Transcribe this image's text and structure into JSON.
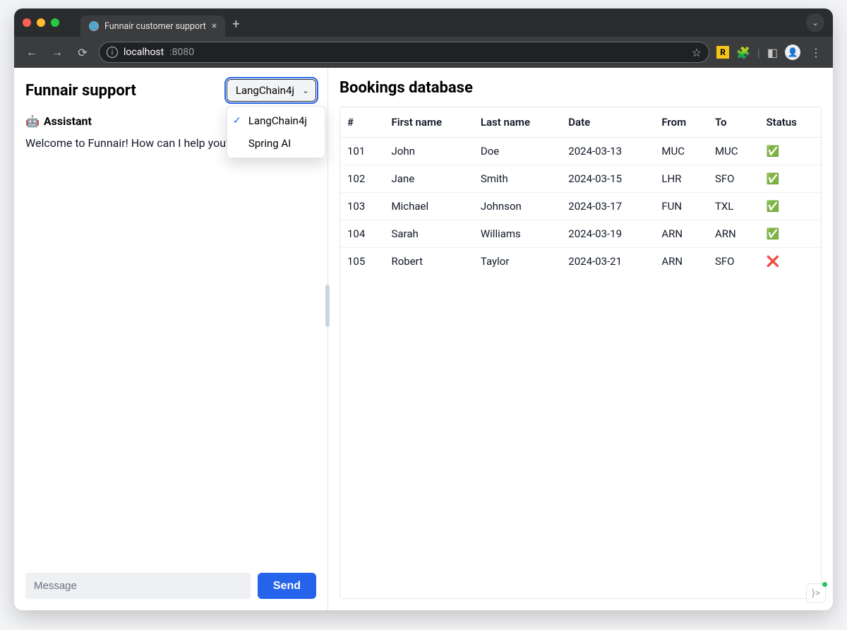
{
  "browser": {
    "tab_title": "Funnair customer support",
    "url_host": "localhost",
    "url_port": ":8080"
  },
  "left": {
    "title": "Funnair support",
    "select": {
      "value": "LangChain4j",
      "options": [
        "LangChain4j",
        "Spring AI"
      ]
    },
    "assistant_label": "Assistant",
    "assistant_emoji": "🤖",
    "welcome": "Welcome to Funnair! How can I help you?",
    "composer": {
      "placeholder": "Message",
      "send_label": "Send"
    }
  },
  "right": {
    "title": "Bookings database",
    "columns": [
      "#",
      "First name",
      "Last name",
      "Date",
      "From",
      "To",
      "Status"
    ],
    "rows": [
      {
        "id": "101",
        "first": "John",
        "last": "Doe",
        "date": "2024-03-13",
        "from": "MUC",
        "to": "MUC",
        "status": "ok"
      },
      {
        "id": "102",
        "first": "Jane",
        "last": "Smith",
        "date": "2024-03-15",
        "from": "LHR",
        "to": "SFO",
        "status": "ok"
      },
      {
        "id": "103",
        "first": "Michael",
        "last": "Johnson",
        "date": "2024-03-17",
        "from": "FUN",
        "to": "TXL",
        "status": "ok"
      },
      {
        "id": "104",
        "first": "Sarah",
        "last": "Williams",
        "date": "2024-03-19",
        "from": "ARN",
        "to": "ARN",
        "status": "ok"
      },
      {
        "id": "105",
        "first": "Robert",
        "last": "Taylor",
        "date": "2024-03-21",
        "from": "ARN",
        "to": "SFO",
        "status": "bad"
      }
    ]
  },
  "status_glyph": {
    "ok": "✅",
    "bad": "❌"
  }
}
